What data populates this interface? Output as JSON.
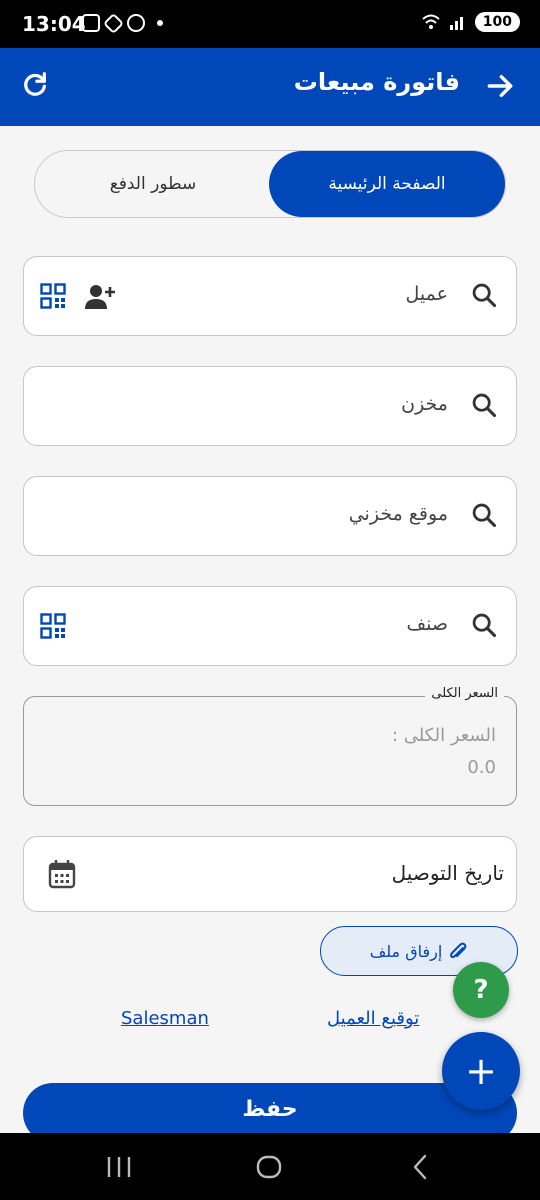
{
  "status_bar": {
    "time": "13:04",
    "battery": "100",
    "signal_label": "5"
  },
  "app_bar": {
    "title": "فاتورة مبيعات",
    "back_icon": "arrow-right-icon",
    "refresh_icon": "refresh-icon"
  },
  "tabs": [
    {
      "label": "الصفحة الرئيسية",
      "active": true
    },
    {
      "label": "سطور الدفع",
      "active": false
    }
  ],
  "fields": {
    "customer": {
      "label": "عميل",
      "icons": [
        "search-icon",
        "qr-code-icon",
        "add-person-icon"
      ]
    },
    "warehouse": {
      "label": "مخزن",
      "icons": [
        "search-icon"
      ]
    },
    "location": {
      "label": "موقع مخزني",
      "icons": [
        "search-icon"
      ]
    },
    "item": {
      "label": "صنف",
      "icons": [
        "search-icon",
        "qr-code-icon"
      ]
    }
  },
  "total_price": {
    "legend": "السعر الكلى",
    "caption": "السعر الكلى :",
    "value": "0.0"
  },
  "delivery_date": {
    "label": "تاريخ التوصيل",
    "icon": "calendar-icon"
  },
  "attach": {
    "label": "إرفاق ملف",
    "icon": "paperclip-icon"
  },
  "help": {
    "label": "?"
  },
  "links": {
    "salesman": "Salesman",
    "customer_signature": "توقيع العميل"
  },
  "fab": {
    "label": "+"
  },
  "save": {
    "label": "حفظ"
  },
  "colors": {
    "primary": "#0047b9",
    "help": "#2e9b4a",
    "background": "#f5f5f5"
  }
}
